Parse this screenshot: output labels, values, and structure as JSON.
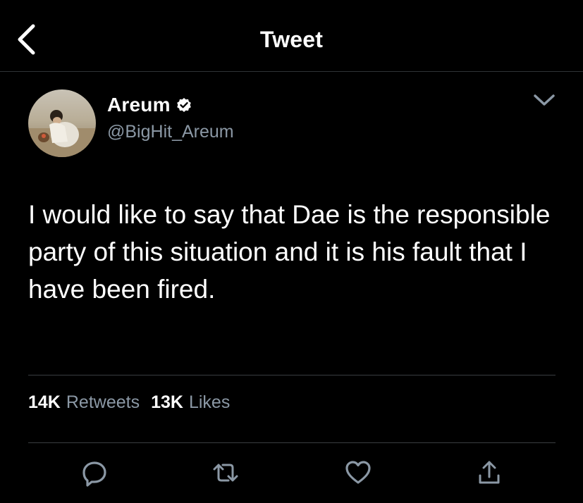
{
  "header": {
    "back_icon": "chevron-left-icon",
    "title": "Tweet"
  },
  "author": {
    "name": "Areum",
    "handle": "@BigHit_Areum",
    "verified_icon": "verified-badge-icon"
  },
  "tweet": {
    "text": "I would like to say that Dae is the responsible party of this situation and it is his fault that I have been fired.",
    "menu_icon": "chevron-down-icon"
  },
  "stats": {
    "retweets_count": "14K",
    "retweets_label": "Retweets",
    "likes_count": "13K",
    "likes_label": "Likes"
  },
  "actions": [
    {
      "icon": "reply-icon"
    },
    {
      "icon": "retweet-icon"
    },
    {
      "icon": "heart-icon"
    },
    {
      "icon": "share-icon"
    }
  ],
  "colors": {
    "background": "#000000",
    "text": "#ffffff",
    "secondary_text": "#8b98a5",
    "divider": "#2f3336"
  }
}
